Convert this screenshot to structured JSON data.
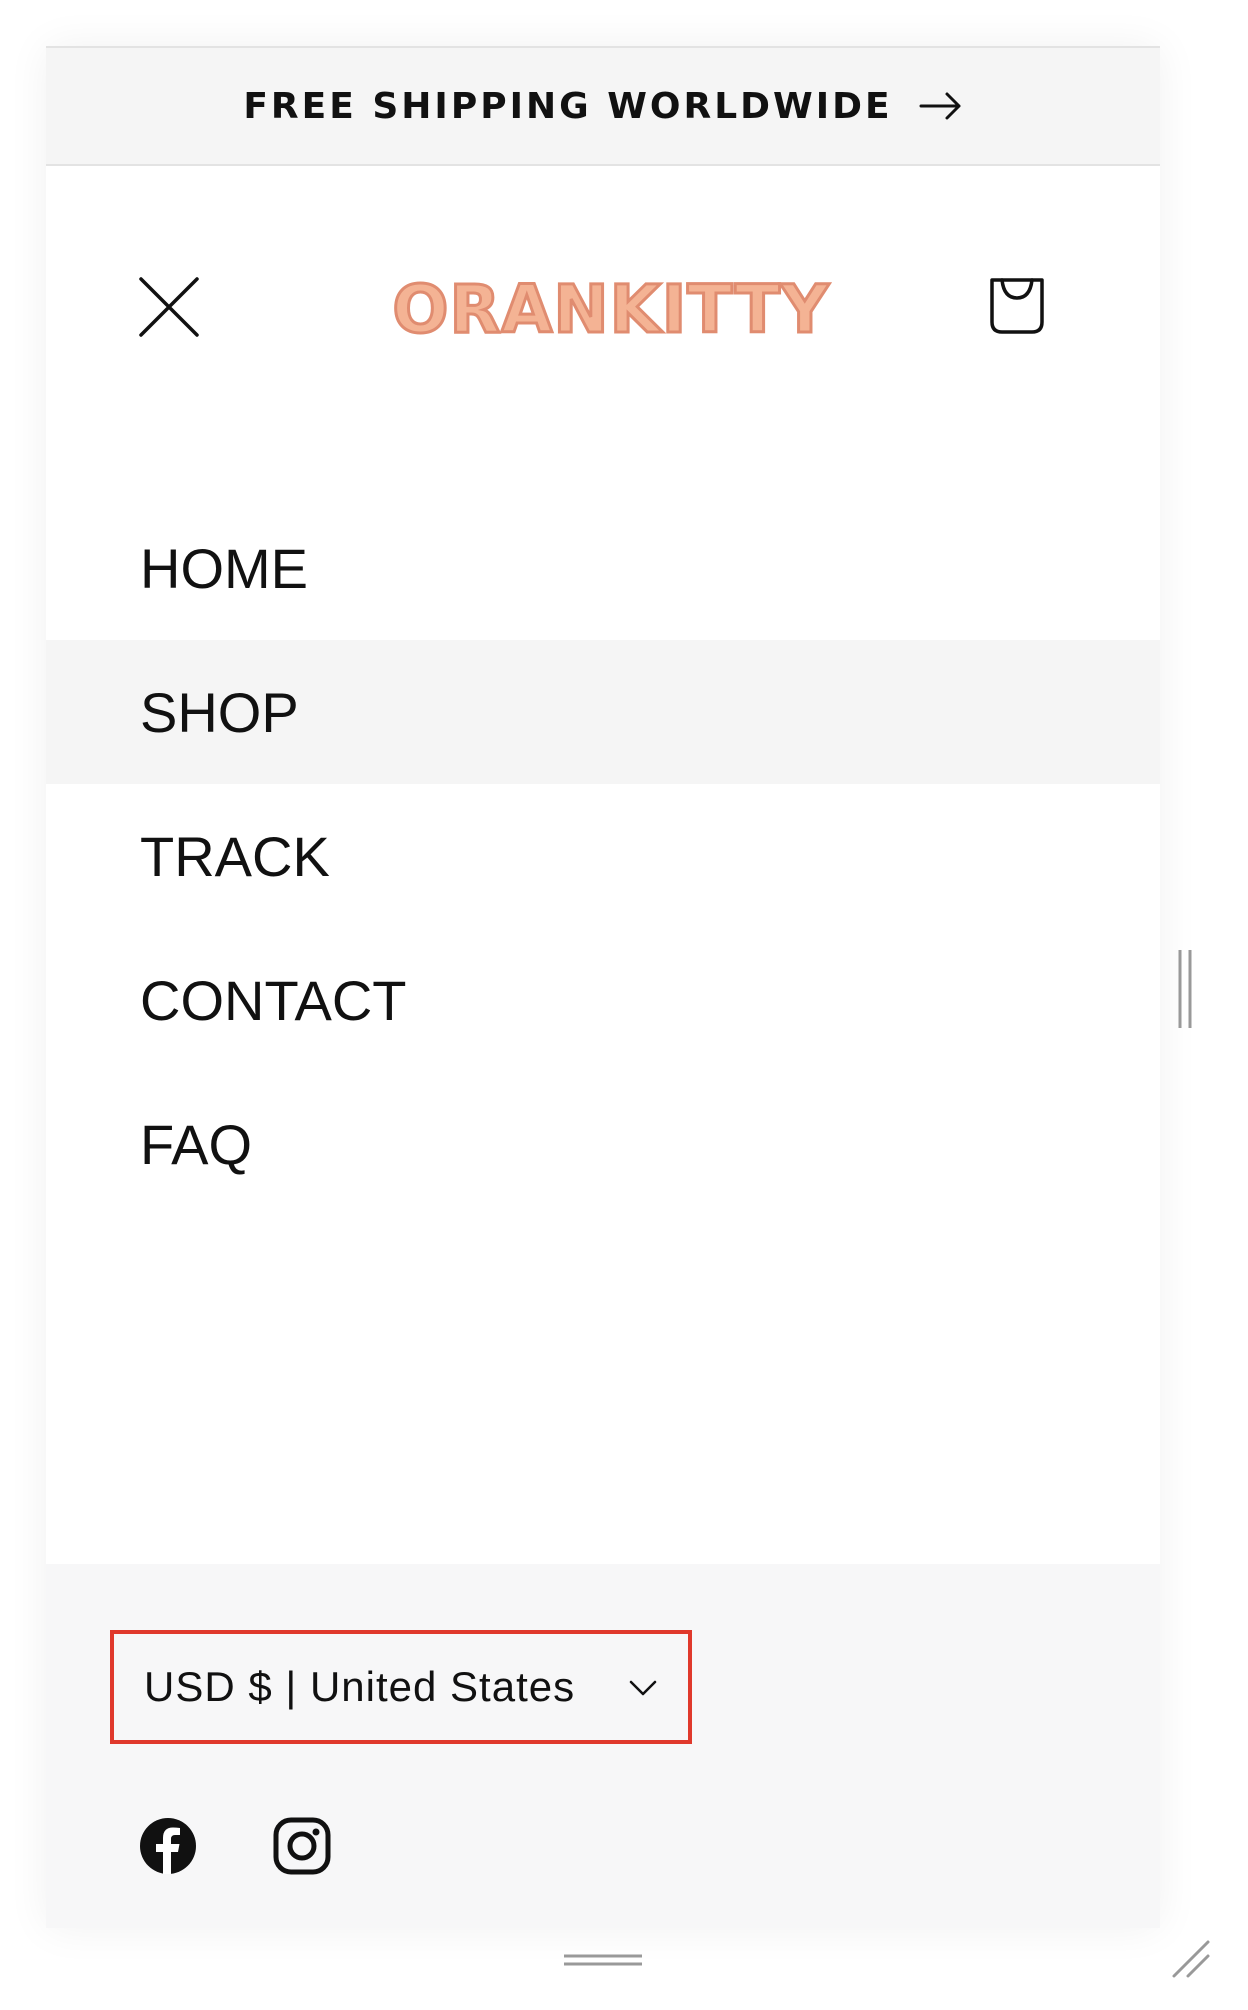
{
  "announcement": {
    "text": "FREE SHIPPING WORLDWIDE",
    "arrow_icon": "arrow-right-icon"
  },
  "header": {
    "close_icon": "close-icon",
    "logo_text": "ORANKITTY",
    "cart_icon": "shopping-bag-icon"
  },
  "menu": {
    "items": [
      {
        "label": "HOME"
      },
      {
        "label": "SHOP"
      },
      {
        "label": "TRACK"
      },
      {
        "label": "CONTACT"
      },
      {
        "label": "FAQ"
      }
    ],
    "active_label": "SHOP"
  },
  "footer": {
    "locale_label": "USD $ | United States",
    "chevron_icon": "chevron-down-icon",
    "highlight_color": "#e0392c",
    "social": [
      {
        "icon": "facebook-icon"
      },
      {
        "icon": "instagram-icon"
      }
    ]
  },
  "colors": {
    "logo_fill": "#f4b394",
    "logo_stroke": "#e08c70",
    "active_row_bg": "#f5f5f5",
    "footer_bg": "#f7f7f8"
  }
}
